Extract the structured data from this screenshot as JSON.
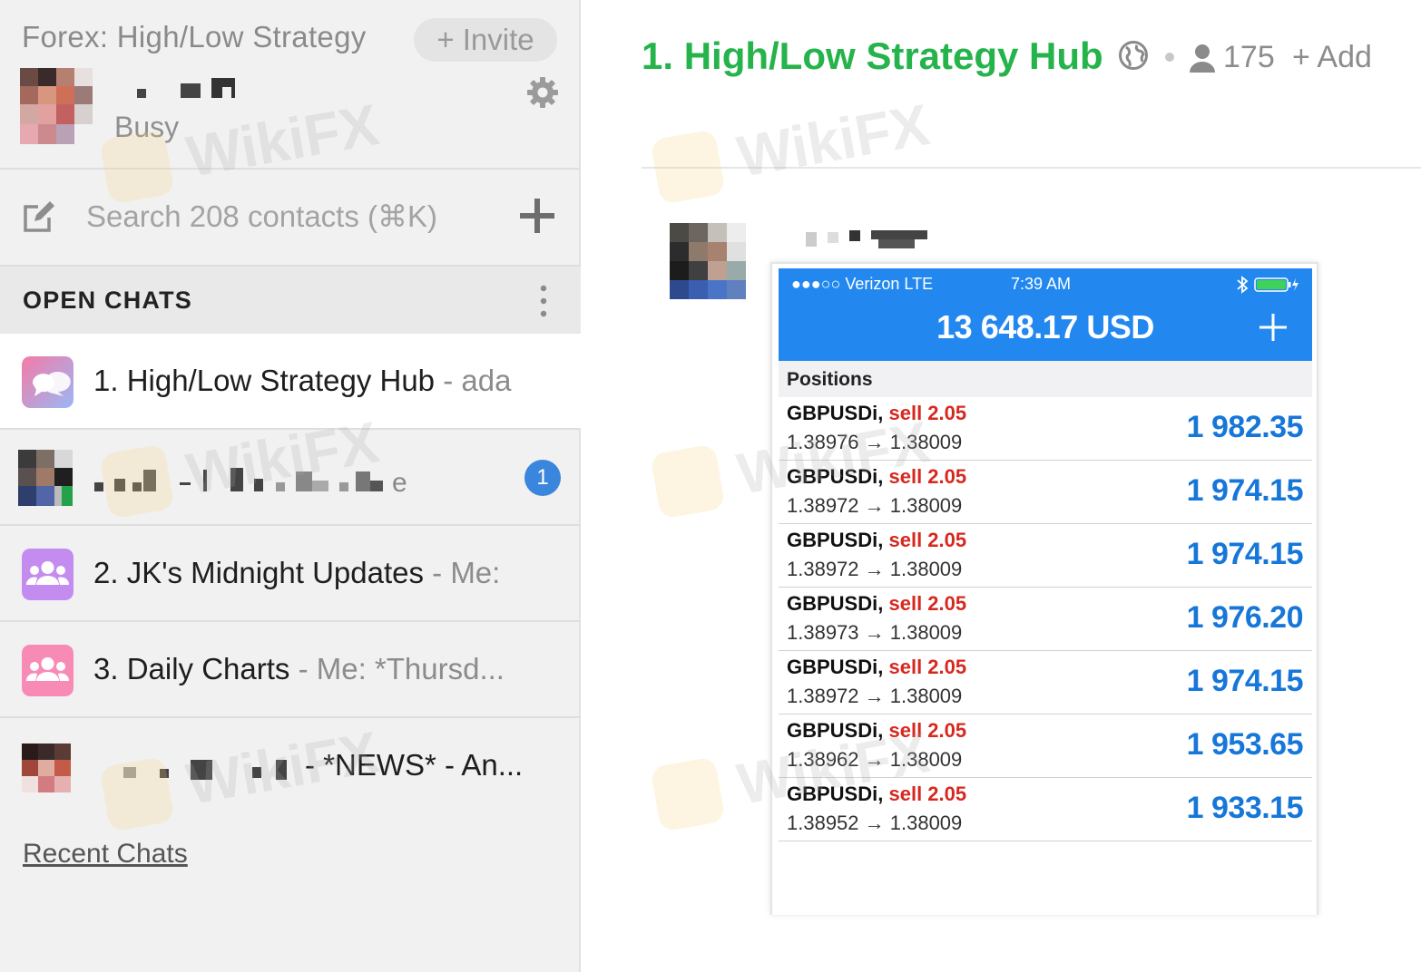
{
  "sidebar": {
    "team_name": "Forex: High/Low Strategy",
    "invite_label": "+ Invite",
    "user_status": "Busy",
    "search_placeholder": "Search 208 contacts (⌘K)",
    "open_chats_label": "OPEN CHATS",
    "chats": [
      {
        "title": "1. High/Low Strategy Hub",
        "preview": " - ada",
        "icon": "chat-bubbles-icon",
        "color": "#f07fb0"
      },
      {
        "title": "",
        "preview": "",
        "badge": "1",
        "icon": "avatar"
      },
      {
        "title": "2. JK's Midnight Updates",
        "preview": " - Me:",
        "icon": "group-icon",
        "color": "#c58cf0"
      },
      {
        "title": "3. Daily Charts",
        "preview": " - Me: *Thursd...",
        "icon": "group-icon",
        "color": "#f78bb6"
      },
      {
        "title": "",
        "preview": "- *NEWS* - An...",
        "icon": "avatar"
      }
    ],
    "recent_chats_label": "Recent Chats"
  },
  "channel": {
    "title": "1. High/Low Strategy Hub",
    "member_count": "175",
    "add_label": "+ Add",
    "accent": "#25b34b"
  },
  "phone": {
    "carrier": "●●●○○ Verizon   LTE",
    "time": "7:39 AM",
    "balance": "13 648.17 USD",
    "positions_label": "Positions",
    "bar_color": "#2288f0",
    "positions": [
      {
        "symbol": "GBPUSDi,",
        "side": "sell 2.05",
        "prices": "1.38976 → 1.38009",
        "profit": "1 982.35"
      },
      {
        "symbol": "GBPUSDi,",
        "side": "sell 2.05",
        "prices": "1.38972 → 1.38009",
        "profit": "1 974.15"
      },
      {
        "symbol": "GBPUSDi,",
        "side": "sell 2.05",
        "prices": "1.38972 → 1.38009",
        "profit": "1 974.15"
      },
      {
        "symbol": "GBPUSDi,",
        "side": "sell 2.05",
        "prices": "1.38973 → 1.38009",
        "profit": "1 976.20"
      },
      {
        "symbol": "GBPUSDi,",
        "side": "sell 2.05",
        "prices": "1.38972 → 1.38009",
        "profit": "1 974.15"
      },
      {
        "symbol": "GBPUSDi,",
        "side": "sell 2.05",
        "prices": "1.38962 → 1.38009",
        "profit": "1 953.65"
      },
      {
        "symbol": "GBPUSDi,",
        "side": "sell 2.05",
        "prices": "1.38952 → 1.38009",
        "profit": "1 933.15"
      }
    ]
  },
  "watermark": "WikiFX"
}
